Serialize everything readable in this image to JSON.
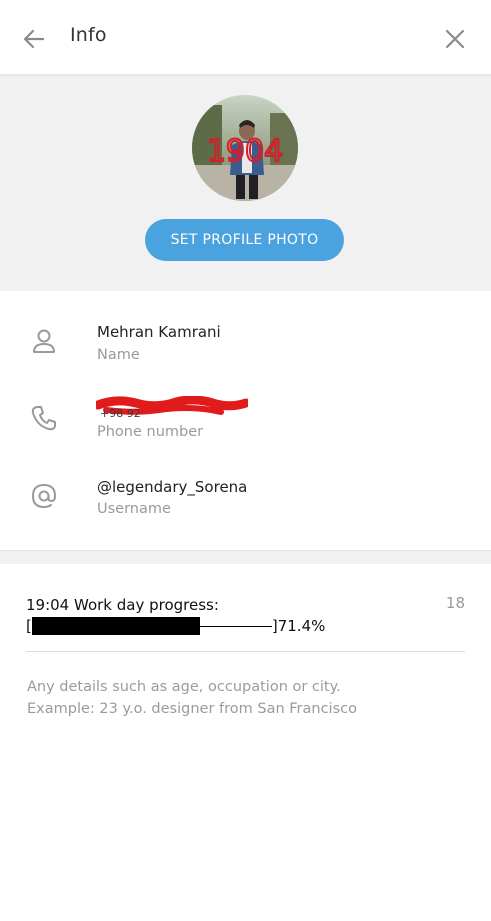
{
  "header": {
    "title": "Info",
    "back_icon": "arrow-left-icon",
    "close_icon": "close-icon"
  },
  "profile": {
    "avatar_overlay_text": "1904",
    "set_photo_label": "SET PROFILE PHOTO",
    "accent_color": "#4aa3df"
  },
  "info": {
    "name": {
      "value": "Mehran Kamrani",
      "label": "Name",
      "icon": "user-icon"
    },
    "phone": {
      "value": "",
      "label": "Phone number",
      "icon": "phone-icon",
      "redacted": true
    },
    "username": {
      "value": "@legendary_Sorena",
      "label": "Username",
      "icon": "at-sign-icon"
    }
  },
  "bio": {
    "line1": "19:04 Work day progress:",
    "bracket_open": "[",
    "bracket_close": "]",
    "progress_percent_text": "71.4%",
    "progress_fraction": 0.714,
    "char_count": "18"
  },
  "hint": {
    "line1": "Any details such as age, occupation or city.",
    "line2": "Example: 23 y.o. designer from San Francisco"
  }
}
